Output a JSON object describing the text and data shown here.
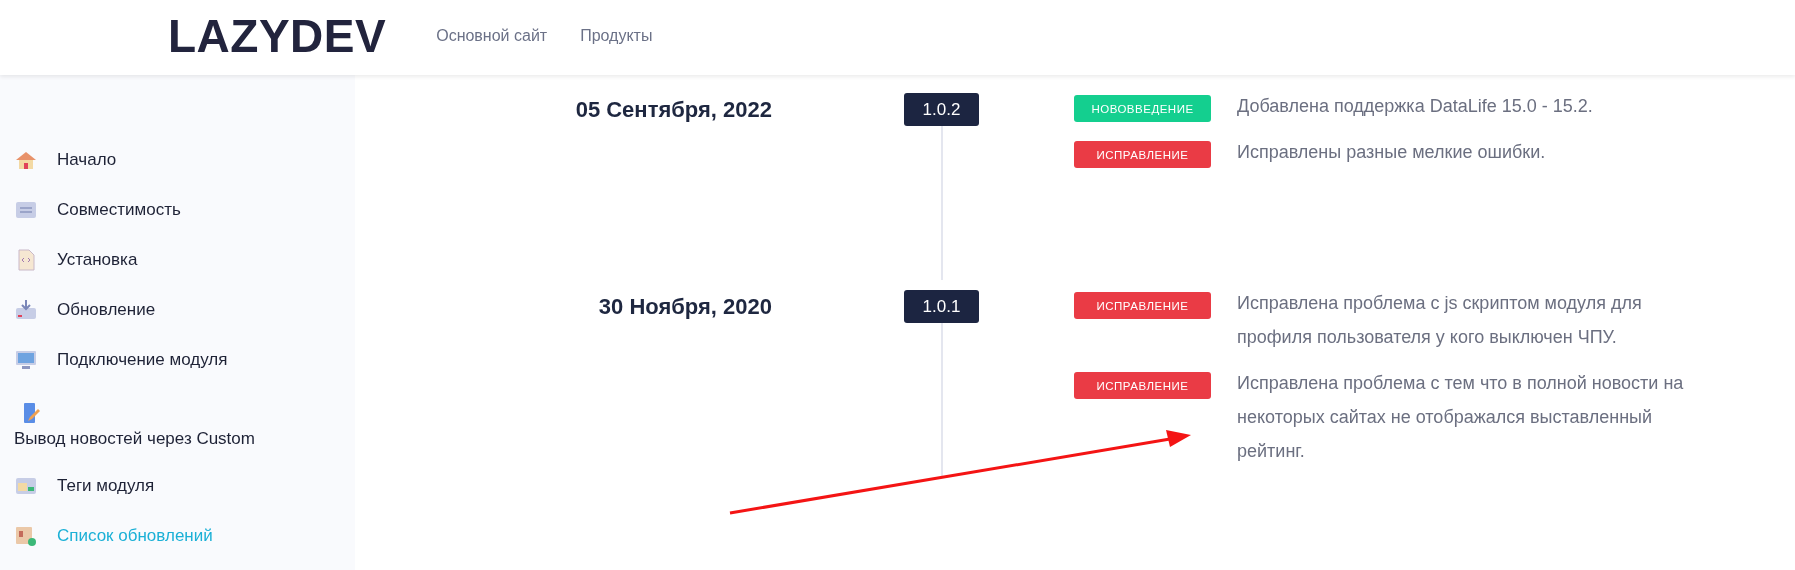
{
  "header": {
    "logo": "LAZYDEV",
    "nav": [
      "Основной сайт",
      "Продукты"
    ]
  },
  "sidebar": {
    "items": [
      {
        "label": "Начало",
        "kind": "inline",
        "selected": false
      },
      {
        "label": "Совместимость",
        "kind": "inline",
        "selected": false
      },
      {
        "label": "Установка",
        "kind": "inline",
        "selected": false
      },
      {
        "label": "Обновление",
        "kind": "inline",
        "selected": false
      },
      {
        "label": "Подключение модуля",
        "kind": "inline",
        "selected": false
      },
      {
        "label": "Вывод новостей через Custom",
        "kind": "stacked",
        "selected": false
      },
      {
        "label": "Теги модуля",
        "kind": "inline",
        "selected": false
      },
      {
        "label": "Список обновлений",
        "kind": "inline",
        "selected": true
      }
    ]
  },
  "releases": [
    {
      "date": "05 Сентября, 2022",
      "version": "1.0.2",
      "changes": [
        {
          "kind": "new",
          "tag": "НОВОВВЕДЕНИЕ",
          "text": "Добавлена поддержка DataLife 15.0 - 15.2."
        },
        {
          "kind": "fix",
          "tag": "ИСПРАВЛЕНИЕ",
          "text": "Исправлены разные мелкие ошибки."
        }
      ]
    },
    {
      "date": "30 Ноября, 2020",
      "version": "1.0.1",
      "changes": [
        {
          "kind": "fix",
          "tag": "ИСПРАВЛЕНИЕ",
          "text": "Исправлена проблема с js скриптом модуля для профиля пользователя у кого выключен ЧПУ."
        },
        {
          "kind": "fix",
          "tag": "ИСПРАВЛЕНИЕ",
          "text": "Исправлена проблема с тем что в полной новости на некоторых сайтах не отображался выставленный рейтинг."
        }
      ]
    }
  ]
}
